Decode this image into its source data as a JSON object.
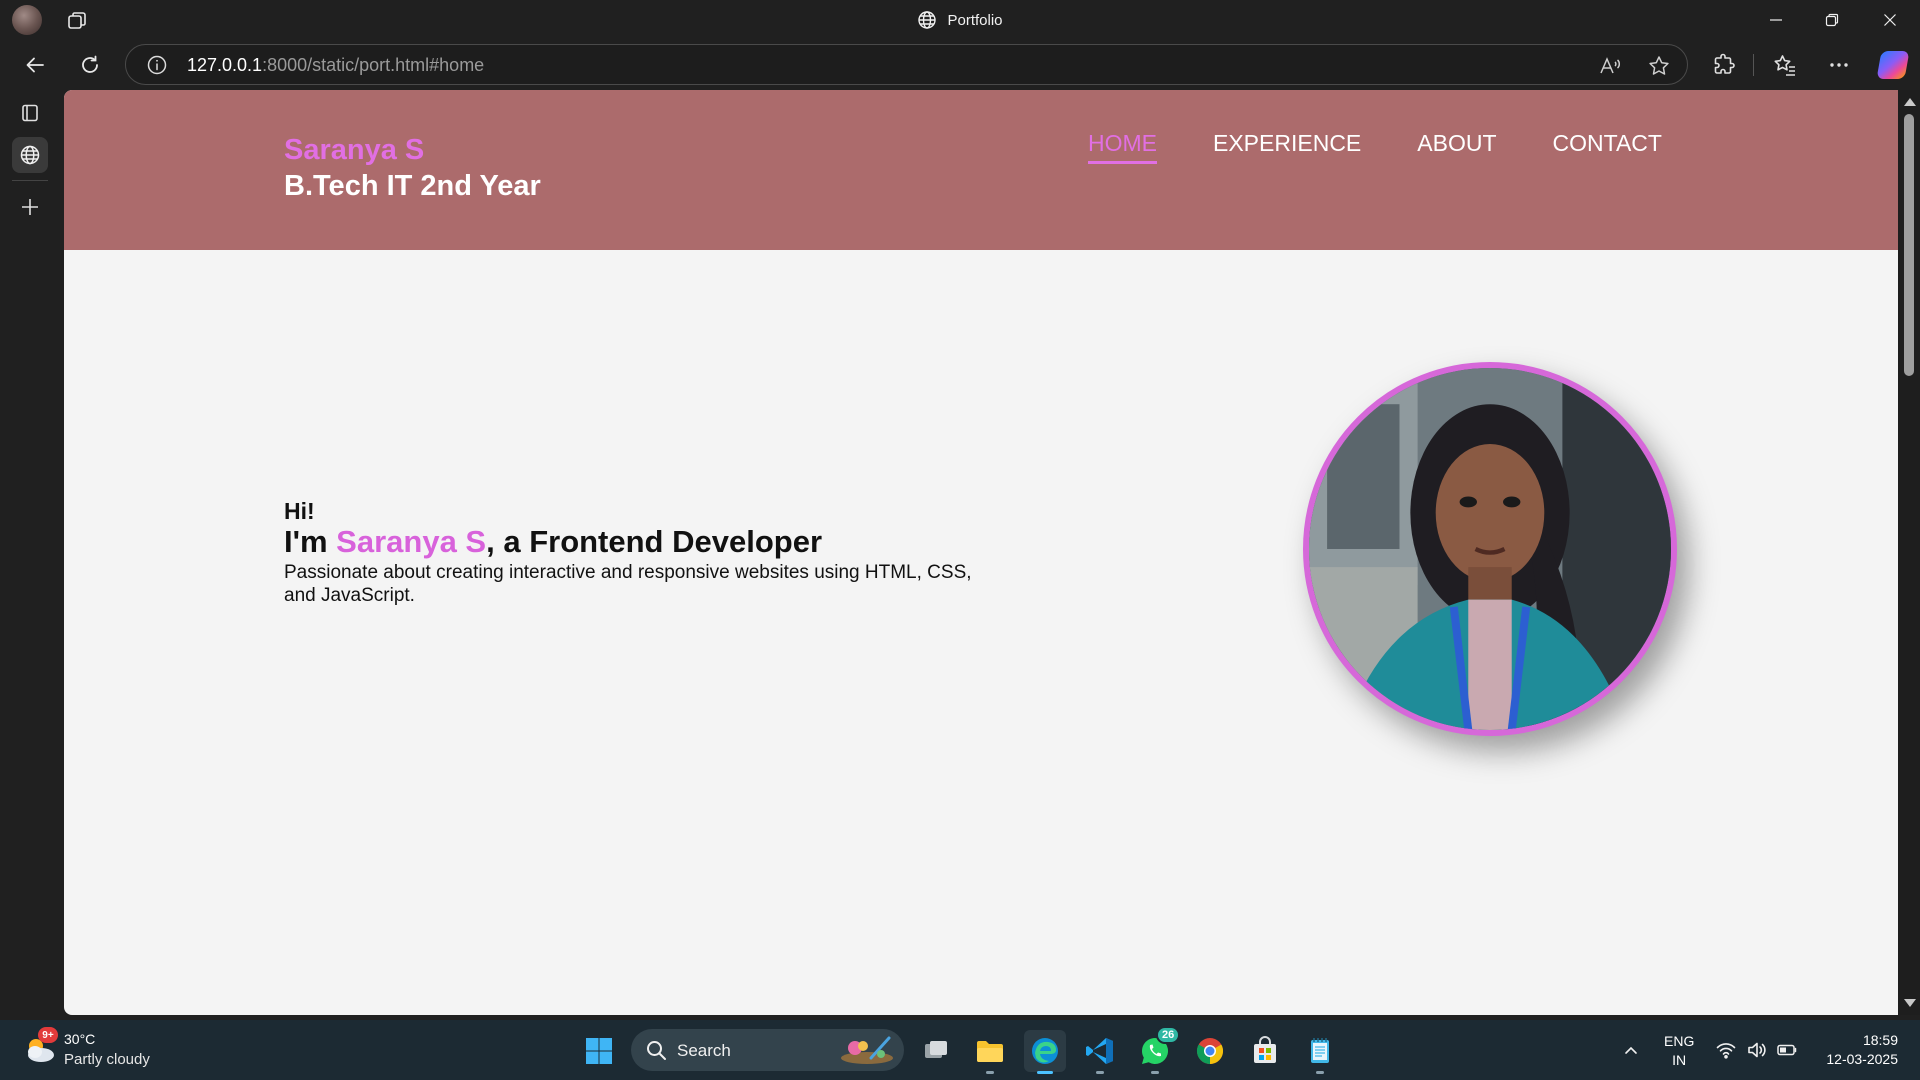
{
  "browser": {
    "window_title": "Portfolio",
    "url_host": "127.0.0.1",
    "url_rest": ":8000/static/port.html#home"
  },
  "site": {
    "brand_name": "Saranya S",
    "brand_subtitle": "B.Tech IT 2nd Year",
    "nav": [
      {
        "label": "HOME",
        "active": true
      },
      {
        "label": "EXPERIENCE",
        "active": false
      },
      {
        "label": "ABOUT",
        "active": false
      },
      {
        "label": "CONTACT",
        "active": false
      }
    ],
    "hero": {
      "greeting": "Hi!",
      "intro_prefix": "I'm ",
      "intro_name": "Saranya S",
      "intro_suffix": ", a Frontend Developer",
      "description": "Passionate about creating interactive and responsive websites using HTML, CSS, and JavaScript."
    },
    "colors": {
      "header_bg": "#ac6b6c",
      "accent_pink": "#e16fe3",
      "page_bg": "#f4f4f4"
    }
  },
  "taskbar": {
    "weather_badge": "9+",
    "weather_temp": "30°C",
    "weather_desc": "Partly cloudy",
    "search_label": "Search",
    "whatsapp_badge": "26",
    "language_line1": "ENG",
    "language_line2": "IN",
    "time": "18:59",
    "date": "12-03-2025"
  },
  "icons": {
    "tabs": "tab-actions-icon",
    "globe": "globe-icon",
    "back": "back-arrow-icon",
    "refresh": "refresh-icon",
    "info": "info-icon",
    "read_aloud": "read-aloud-icon",
    "favorite": "star-icon",
    "extensions": "extensions-icon",
    "favorites": "favorites-icon",
    "more": "more-icon",
    "copilot": "copilot-icon"
  }
}
